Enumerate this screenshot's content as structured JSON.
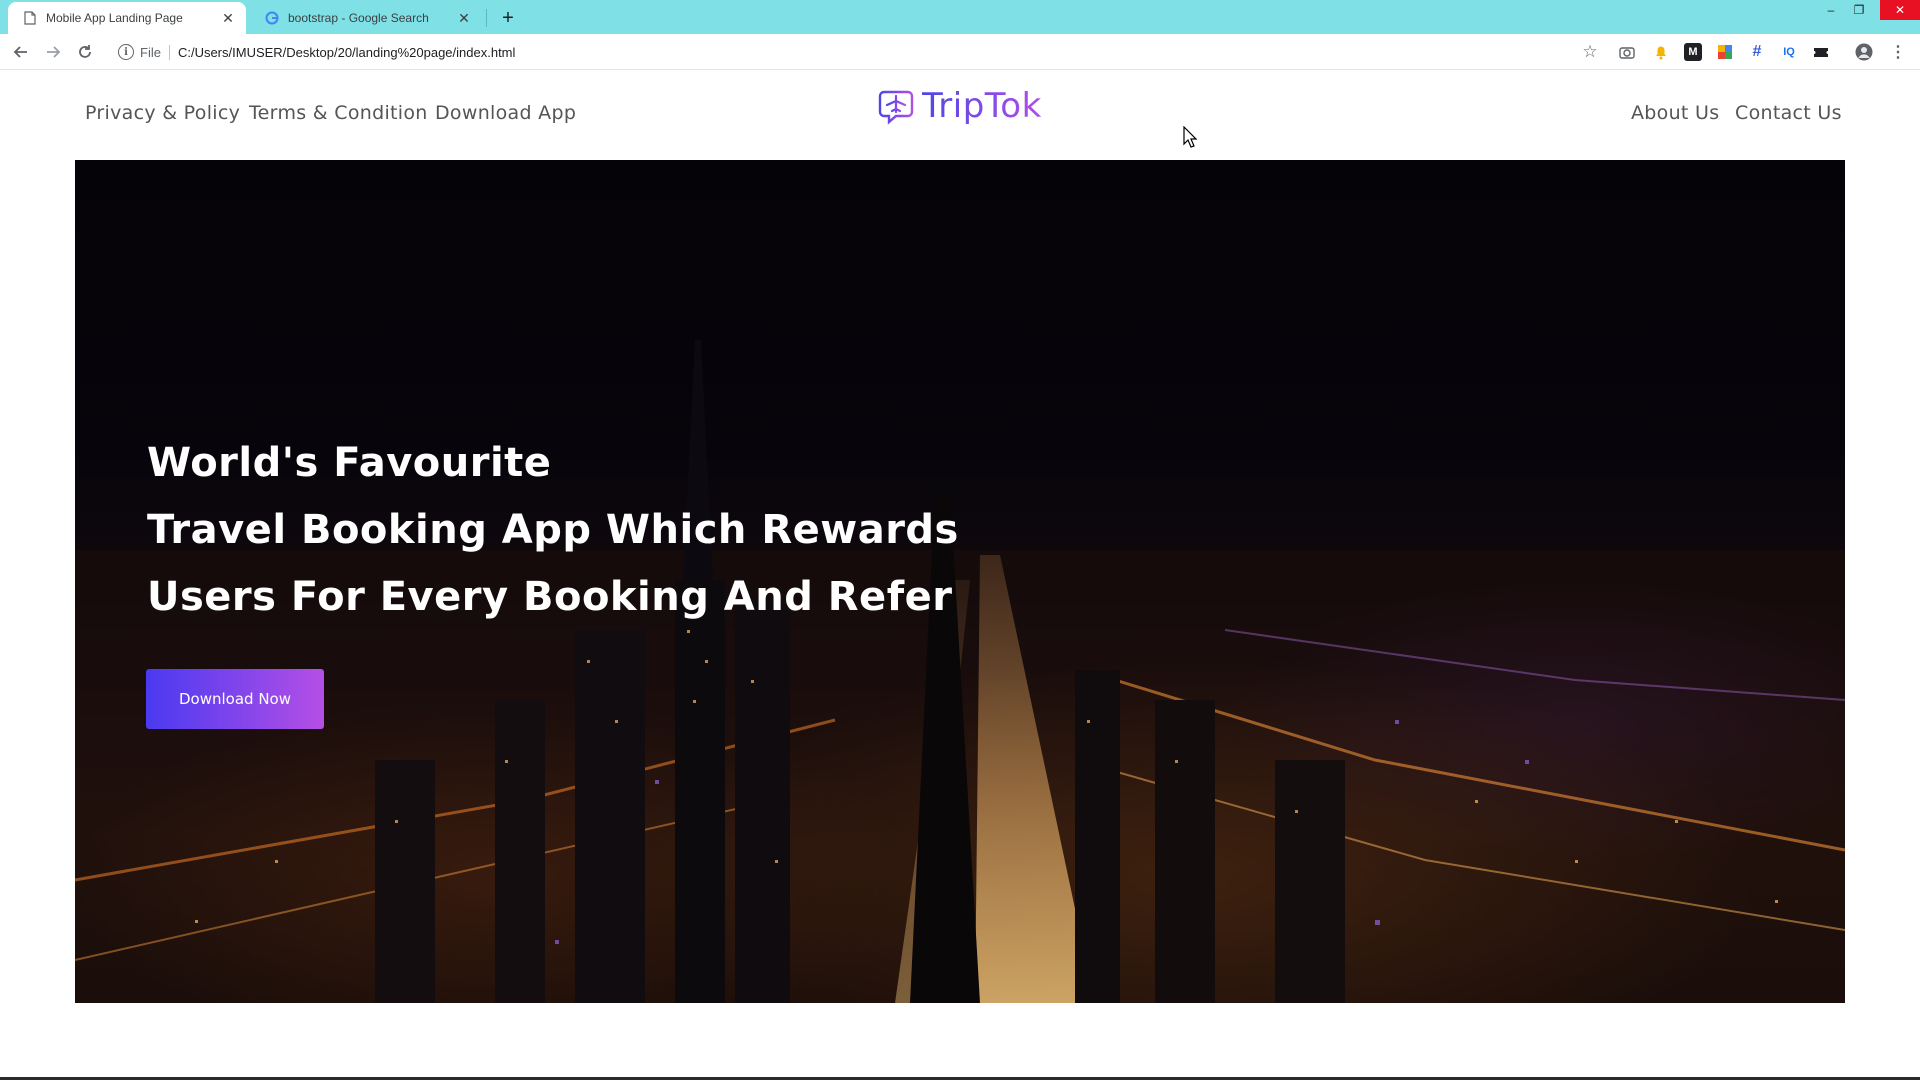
{
  "browser": {
    "tabs": [
      {
        "title": "Mobile App Landing Page",
        "icon": "page-icon",
        "close": "✕"
      },
      {
        "title": "bootstrap - Google Search",
        "icon": "google-icon",
        "close": "✕"
      }
    ],
    "new_tab": "+",
    "address_scheme": "File",
    "address_url": "C:/Users/IMUSER/Desktop/20/landing%20page/index.html",
    "window_controls": {
      "minimize": "–",
      "maximize": "❐",
      "close": "✕"
    }
  },
  "site": {
    "nav_left": [
      "Privacy & Policy",
      "Terms & Condition",
      "Download App"
    ],
    "logo_text": "TripTok",
    "nav_right": [
      "About Us",
      "Contact Us"
    ]
  },
  "hero": {
    "headline": [
      "World's Favourite",
      "Travel Booking App Which Rewards",
      "Users For Every Booking And Refer"
    ],
    "cta_label": "Download Now"
  },
  "colors": {
    "tabbar": "#7fe0e6",
    "brand_gradient_start": "#4a3af0",
    "brand_gradient_end": "#b54fe6",
    "nav_text": "#555555"
  }
}
